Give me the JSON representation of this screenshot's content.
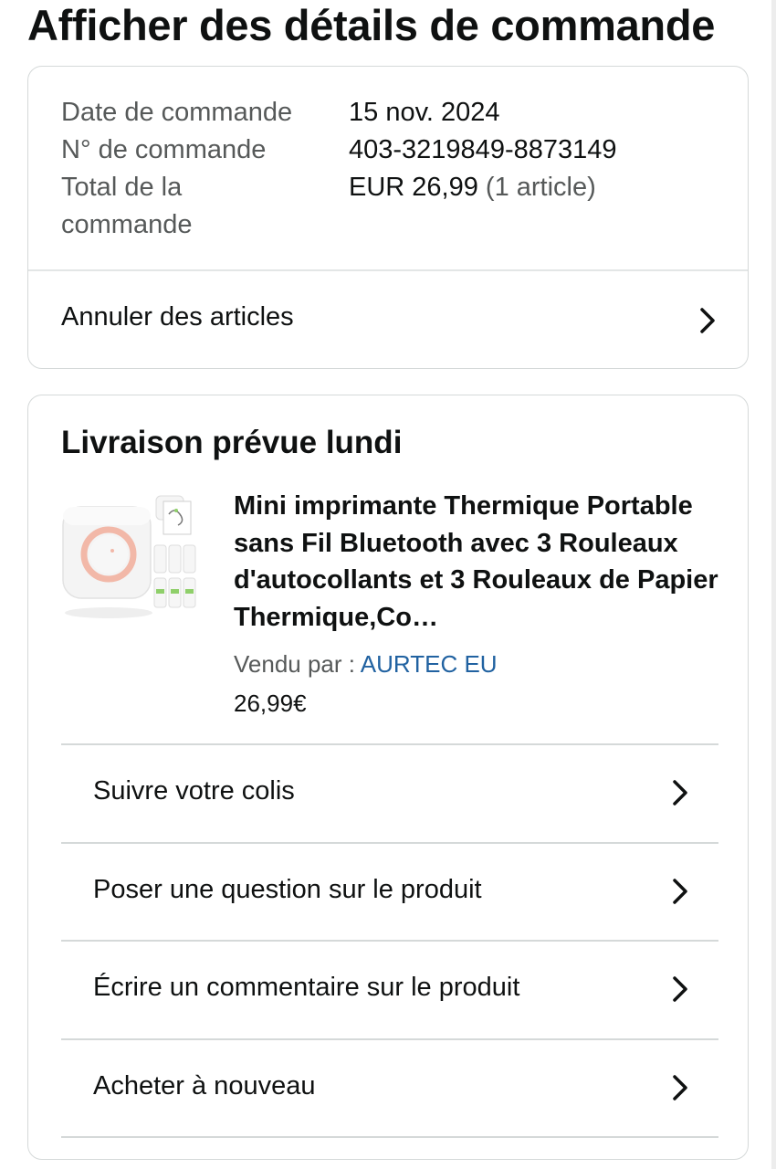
{
  "page_title": "Afficher des détails de commande",
  "summary": {
    "order_date_label": "Date de commande",
    "order_date_value": "15 nov. 2024",
    "order_number_label": "N° de commande",
    "order_number_value": "403-3219849-8873149",
    "order_total_label_line1": "Total de la",
    "order_total_label_line2": "commande",
    "order_total_value": "EUR 26,99",
    "order_item_count": "(1 article)",
    "cancel_label": "Annuler des articles"
  },
  "delivery": {
    "title": "Livraison prévue lundi",
    "product": {
      "title": "Mini imprimante Thermique Portable sans Fil Bluetooth avec 3 Rouleaux d'autocollants et 3 Rouleaux de Papier Thermique,Co…",
      "sold_by_label": "Vendu par  : ",
      "seller": "AURTEC EU",
      "price": "26,99€"
    },
    "actions": [
      {
        "label": "Suivre votre colis",
        "icon": "chevron-right-icon"
      },
      {
        "label": "Poser une question sur le produit",
        "icon": "chevron-right-icon"
      },
      {
        "label": "Écrire un commentaire sur le produit",
        "icon": "chevron-right-icon"
      },
      {
        "label": "Acheter à nouveau",
        "icon": "chevron-right-icon"
      }
    ]
  },
  "colors": {
    "text": "#0f1111",
    "muted_text": "#565959",
    "link": "#2162a1",
    "border": "#d5d9d9"
  }
}
